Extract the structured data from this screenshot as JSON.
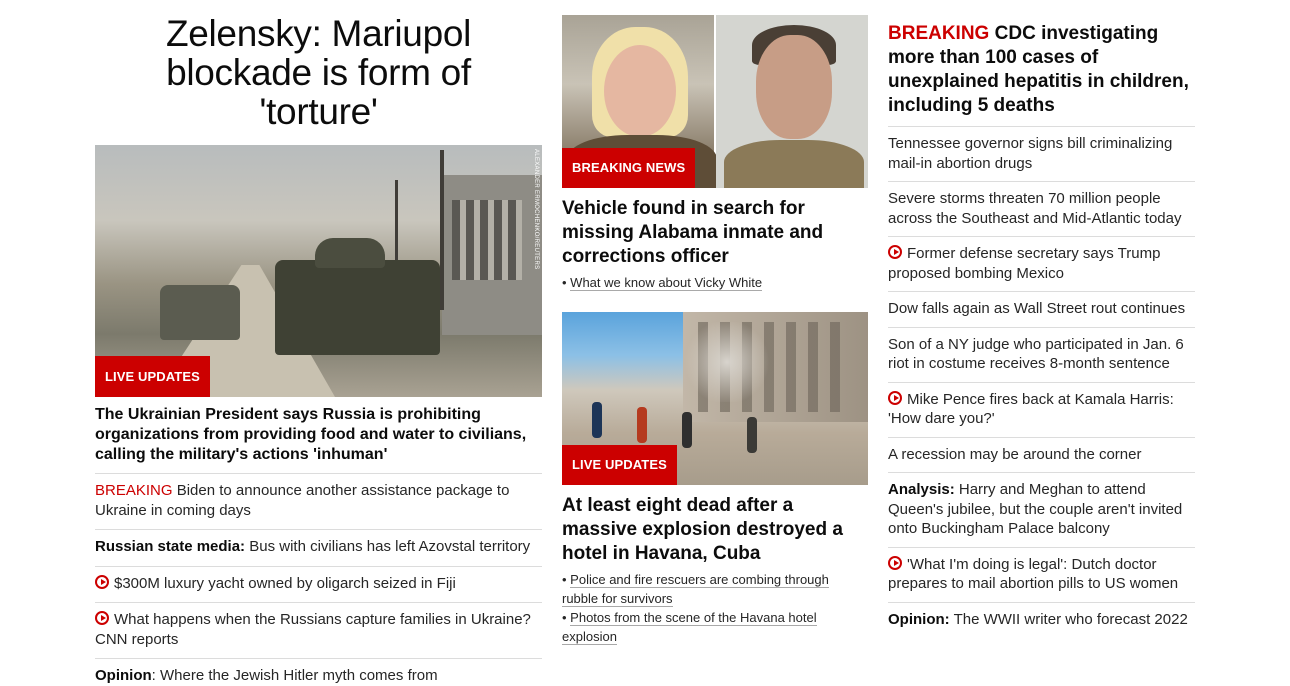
{
  "main_story": {
    "headline": "Zelensky: Mariupol blockade is form of 'torture'",
    "photo_label": "LIVE UPDATES",
    "photo_credit": "ALEXANDER ERMOCHENKO/REUTERS",
    "subheadline": "The Ukrainian President says Russia is prohibiting organizations from providing food and water to civilians, calling the military's actions 'inhuman'",
    "related": [
      {
        "prefix": "BREAKING",
        "text": "Biden to announce another assistance package to Ukraine in coming days",
        "style": "breaking"
      },
      {
        "prefix": "Russian state media:",
        "text": "Bus with civilians has left Azovstal territory",
        "style": "bold"
      },
      {
        "prefix": "",
        "text": "$300M luxury yacht owned by oligarch seized in Fiji",
        "style": "video"
      },
      {
        "prefix": "",
        "text": "What happens when the Russians capture families in Ukraine? CNN reports",
        "style": "video"
      },
      {
        "prefix": "Opinion",
        "text": ": Where the Jewish Hitler myth comes from",
        "style": "bold"
      }
    ]
  },
  "story_alabama": {
    "photo_label": "BREAKING NEWS",
    "headline": "Vehicle found in search for missing Alabama inmate and corrections officer",
    "bullets": [
      "What we know about Vicky White"
    ]
  },
  "story_havana": {
    "photo_label": "LIVE UPDATES",
    "headline": "At least eight dead after a massive explosion destroyed a hotel in Havana, Cuba",
    "bullets": [
      "Police and fire rescuers are combing through rubble for survivors",
      "Photos from the scene of the Havana hotel explosion"
    ]
  },
  "right_column": {
    "headline_prefix": "BREAKING",
    "headline": "CDC investigating more than 100 cases of unexplained hepatitis in children, including 5 deaths",
    "items": [
      {
        "prefix": "",
        "text": "Tennessee governor signs bill criminalizing mail-in abortion drugs",
        "style": "plain"
      },
      {
        "prefix": "",
        "text": "Severe storms threaten 70 million people across the Southeast and Mid-Atlantic today",
        "style": "plain"
      },
      {
        "prefix": "",
        "text": "Former defense secretary says Trump proposed bombing Mexico",
        "style": "video"
      },
      {
        "prefix": "",
        "text": "Dow falls again as Wall Street rout continues",
        "style": "plain"
      },
      {
        "prefix": "",
        "text": "Son of a NY judge who participated in Jan. 6 riot in costume receives 8-month sentence",
        "style": "plain"
      },
      {
        "prefix": "",
        "text": "Mike Pence fires back at Kamala Harris: 'How dare you?'",
        "style": "video"
      },
      {
        "prefix": "",
        "text": "A recession may be around the corner",
        "style": "plain"
      },
      {
        "prefix": "Analysis:",
        "text": "Harry and Meghan to attend Queen's jubilee, but the couple aren't invited onto Buckingham Palace balcony",
        "style": "bold"
      },
      {
        "prefix": "",
        "text": "'What I'm doing is legal': Dutch doctor prepares to mail abortion pills to US women",
        "style": "video"
      },
      {
        "prefix": "Opinion:",
        "text": "The WWII writer who forecast 2022",
        "style": "bold"
      }
    ]
  },
  "colors": {
    "accent_red": "#cc0000",
    "divider": "#dcdcdc",
    "text": "#0c0c0c"
  }
}
